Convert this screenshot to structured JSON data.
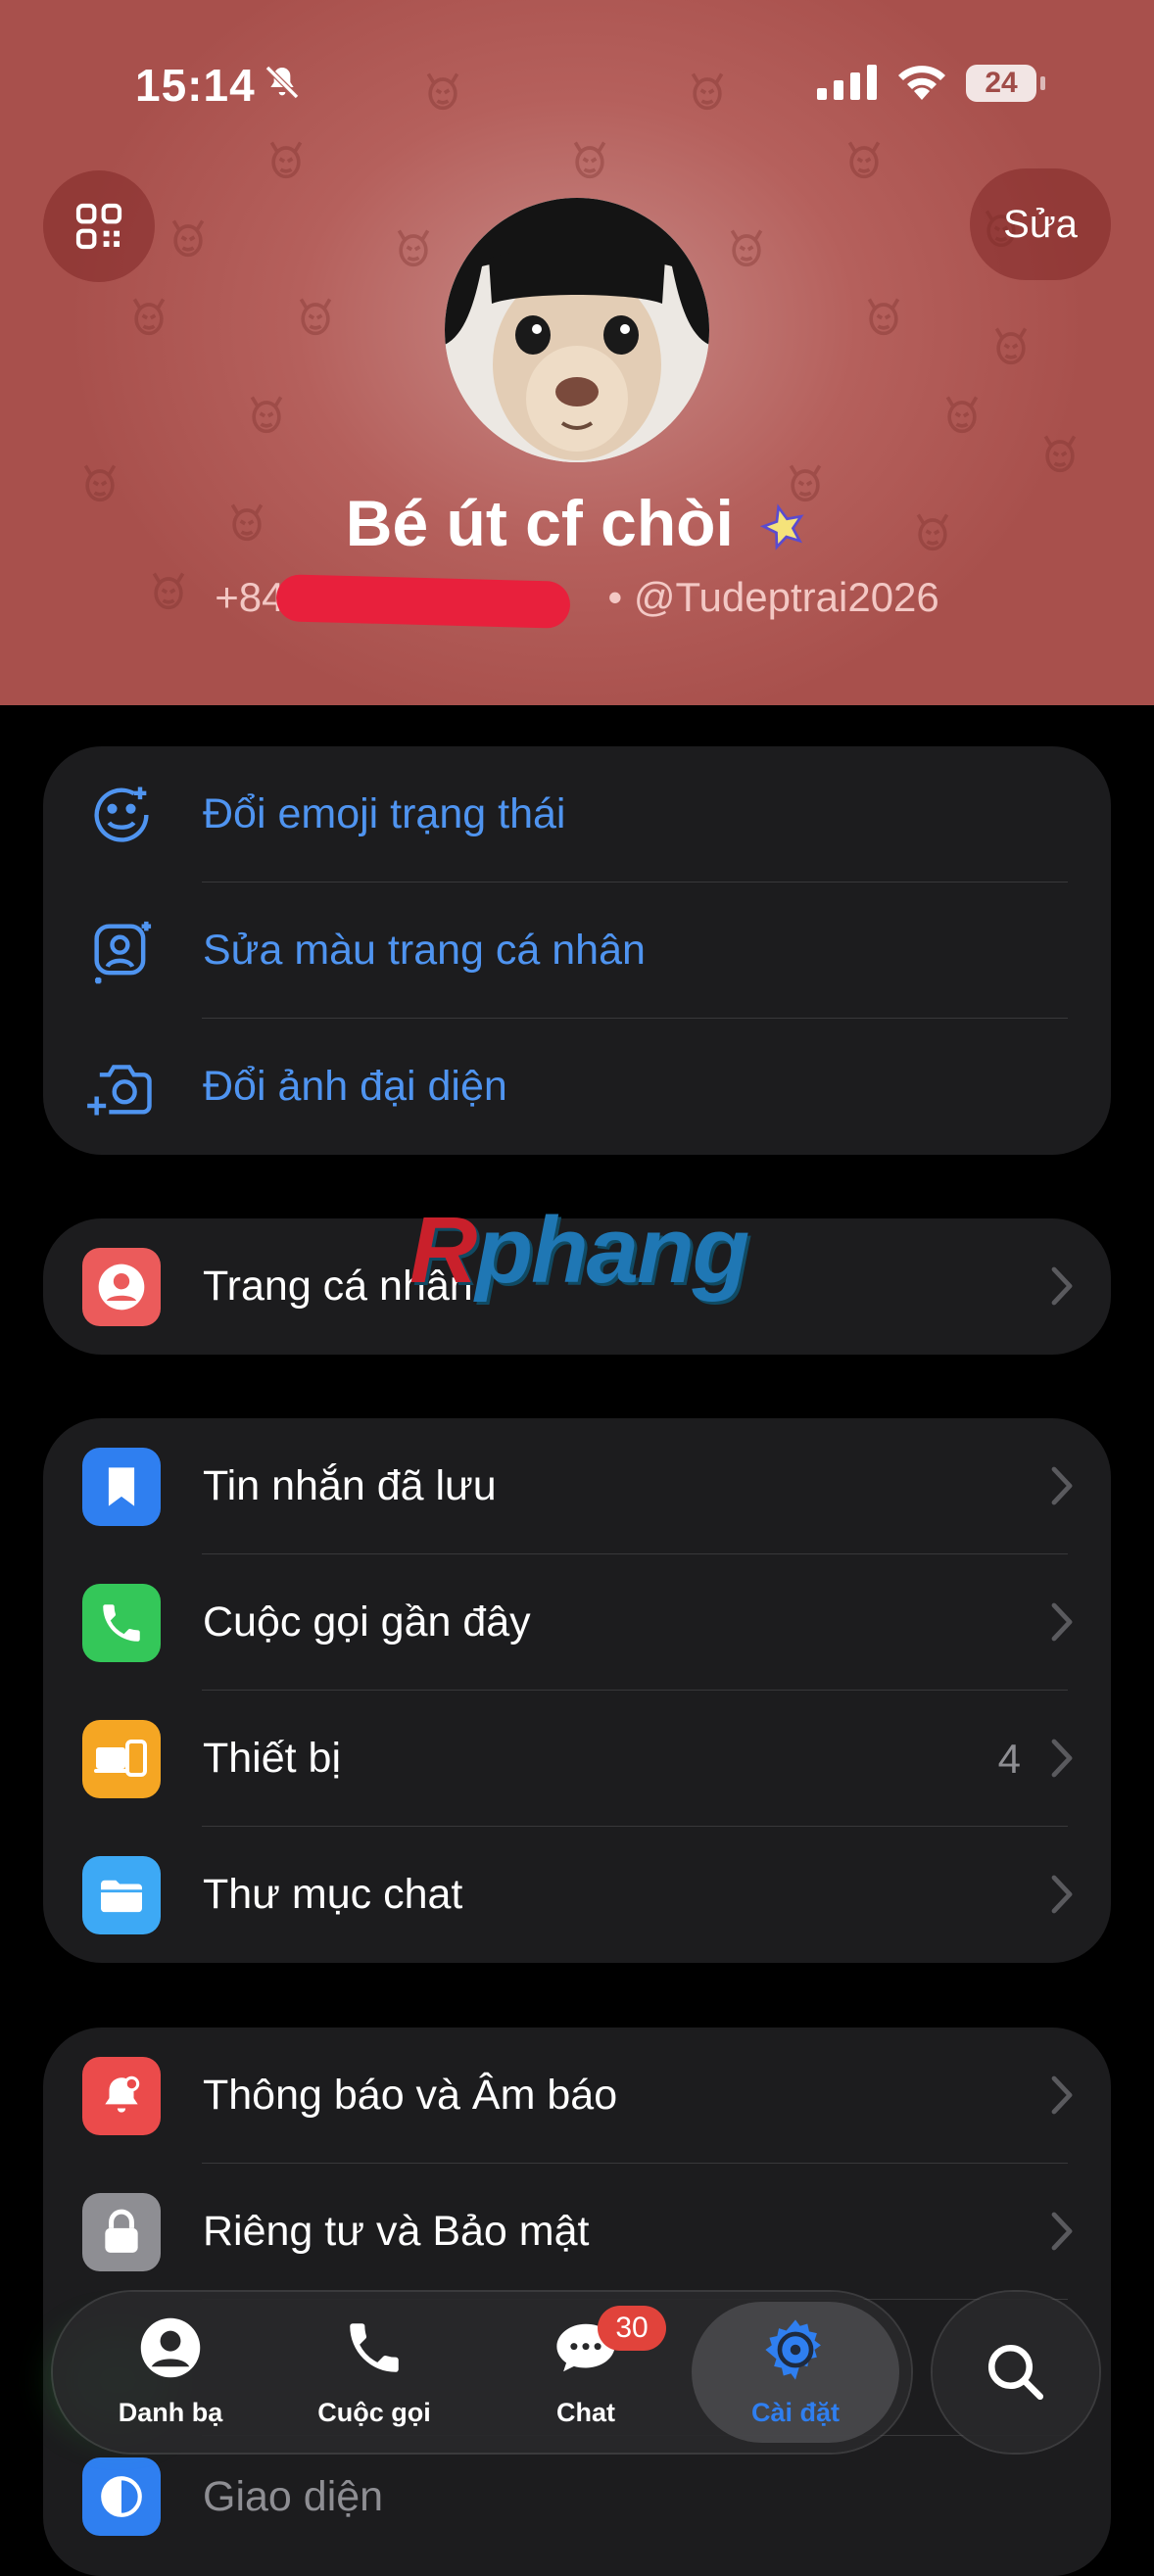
{
  "status_bar": {
    "time": "15:14",
    "battery": "24"
  },
  "header": {
    "edit_label": "Sửa",
    "name": "Bé út cf chòi",
    "phone": "+84",
    "username": "• @Tudeptrai2026"
  },
  "profile_actions": [
    {
      "label": "Đổi emoji trạng thái",
      "icon": "emoji-status-icon"
    },
    {
      "label": "Sửa màu trang cá nhân",
      "icon": "profile-color-icon"
    },
    {
      "label": "Đổi ảnh đại diện",
      "icon": "camera-icon"
    }
  ],
  "watermark": {
    "part1": "R",
    "part2": "phang"
  },
  "group_profile": [
    {
      "label": "Trang cá nhân",
      "icon": "person-icon",
      "color": "#eb5b5b"
    }
  ],
  "group_main": [
    {
      "label": "Tin nhắn đã lưu",
      "icon": "bookmark-icon",
      "color": "#2f7ff0"
    },
    {
      "label": "Cuộc gọi gần đây",
      "icon": "phone-icon",
      "color": "#34c759"
    },
    {
      "label": "Thiết bị",
      "icon": "devices-icon",
      "color": "#f5a623",
      "value": "4"
    },
    {
      "label": "Thư mục chat",
      "icon": "folder-icon",
      "color": "#3da9f5"
    }
  ],
  "group_settings": [
    {
      "label": "Thông báo và Âm báo",
      "icon": "bell-icon",
      "color": "#eb4b4b"
    },
    {
      "label": "Riêng tư và Bảo mật",
      "icon": "lock-icon",
      "color": "#8e8e93"
    },
    {
      "label": "Giao diện",
      "icon": "appearance-icon",
      "color": "#2f7ff0"
    }
  ],
  "tabs": [
    {
      "label": "Danh bạ",
      "icon": "contacts-icon"
    },
    {
      "label": "Cuộc gọi",
      "icon": "phone-icon"
    },
    {
      "label": "Chat",
      "icon": "chat-icon",
      "badge": "30"
    },
    {
      "label": "Cài đặt",
      "icon": "settings-gear-icon",
      "active": true
    }
  ],
  "colors": {
    "accent": "#2f7ff0",
    "header_bg": "#b5605c",
    "group_bg": "#1c1c1e"
  }
}
